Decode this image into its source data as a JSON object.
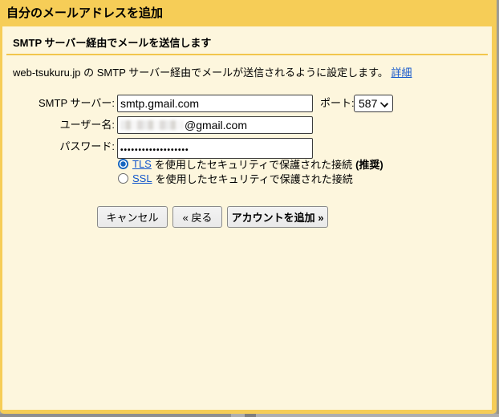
{
  "window": {
    "title": "自分のメールアドレスを追加"
  },
  "panel": {
    "heading": "SMTP サーバー経由でメールを送信します",
    "description": "web-tsukuru.jp の SMTP サーバー経由でメールが送信されるように設定します。",
    "details_link": "詳細"
  },
  "form": {
    "smtp_server_label": "SMTP サーバー:",
    "smtp_server_value": "smtp.gmail.com",
    "port_label": "ポート:",
    "port_value": "587",
    "username_label": "ユーザー名:",
    "username_redacted": true,
    "username_suffix": "@gmail.com",
    "password_label": "パスワード:",
    "password_value": "•••••••••••••••••••",
    "security_options": [
      {
        "link": "TLS",
        "text": "を使用したセキュリティで保護された接続",
        "badge": "(推奨)",
        "selected": true
      },
      {
        "link": "SSL",
        "text": "を使用したセキュリティで保護された接続",
        "badge": "",
        "selected": false
      }
    ]
  },
  "buttons": {
    "cancel": "キャンセル",
    "back": "« 戻る",
    "add_account": "アカウントを追加 »"
  },
  "colors": {
    "header_yellow": "#f6cd57",
    "panel_cream": "#fdf6dd",
    "divider_yellow": "#f2c64c",
    "link_blue": "#1155cc",
    "radio_blue": "#1565c0"
  }
}
